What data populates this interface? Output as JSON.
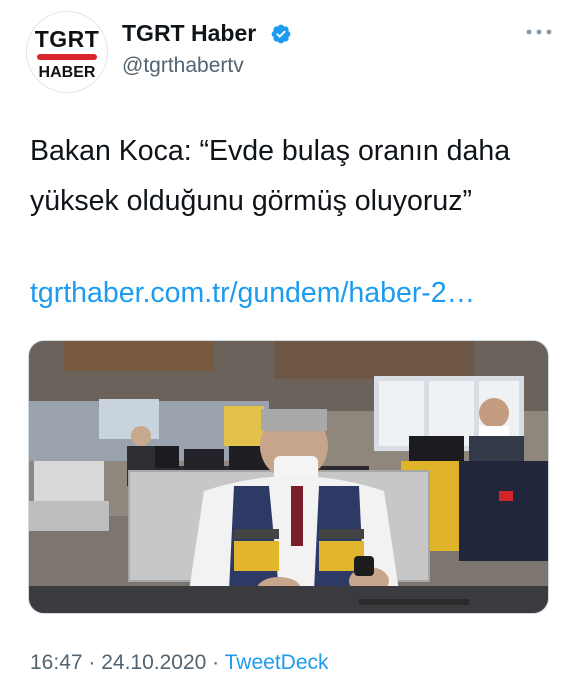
{
  "account": {
    "display_name": "TGRT Haber",
    "handle": "@tgrthabertv",
    "verified": true,
    "avatar_logo_top": "TGRT",
    "avatar_logo_bottom": "HABER"
  },
  "tweet": {
    "text": "Bakan Koca: “Evde bulaş oranın daha yüksek olduğunu görmüş oluyoruz”",
    "link": "tgrthaber.com.tr/gundem/haber-2…"
  },
  "meta": {
    "time": "16:47",
    "sep1": " · ",
    "date": "24.10.2020",
    "sep2": " · ",
    "app": "TweetDeck"
  },
  "colors": {
    "link": "#1d9bf0",
    "secondary_text": "#536471",
    "verified_badge": "#1d9bf0",
    "logo_red": "#d9262c"
  },
  "icons": {
    "verified": "verified-badge-icon",
    "more": "more-options-icon"
  }
}
